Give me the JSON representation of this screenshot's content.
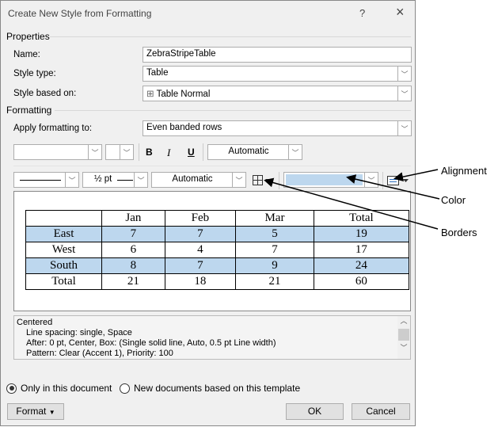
{
  "dialog": {
    "title": "Create New Style from Formatting",
    "help": "?",
    "close": "×"
  },
  "properties": {
    "heading": "Properties",
    "name_label": "Name:",
    "name_value": "ZebraStripeTable",
    "type_label": "Style type:",
    "type_value": "Table",
    "based_label": "Style based on:",
    "based_value": "Table Normal"
  },
  "formatting": {
    "heading": "Formatting",
    "apply_label": "Apply formatting to:",
    "apply_value": "Even banded rows",
    "font": "",
    "size": "",
    "bold": "B",
    "italic": "I",
    "underline": "U",
    "font_color": "Automatic",
    "line_width": "½ pt",
    "border_color": "Automatic",
    "shading_color": "#bdd7ee"
  },
  "preview": {
    "headers": [
      "",
      "Jan",
      "Feb",
      "Mar",
      "Total"
    ],
    "rows": [
      [
        "East",
        "7",
        "7",
        "5",
        "19"
      ],
      [
        "West",
        "6",
        "4",
        "7",
        "17"
      ],
      [
        "South",
        "8",
        "7",
        "9",
        "24"
      ],
      [
        "Total",
        "21",
        "18",
        "21",
        "60"
      ]
    ]
  },
  "description": [
    "Centered",
    "Line spacing:  single, Space",
    "After:  0 pt, Center, Box: (Single solid line, Auto,  0.5 pt Line width)",
    "Pattern: Clear (Accent 1), Priority: 100"
  ],
  "options": {
    "only_doc": "Only in this document",
    "new_docs": "New documents based on this template"
  },
  "buttons": {
    "format": "Format",
    "ok": "OK",
    "cancel": "Cancel"
  },
  "annotations": {
    "alignment": "Alignment",
    "color": "Color",
    "borders": "Borders"
  }
}
